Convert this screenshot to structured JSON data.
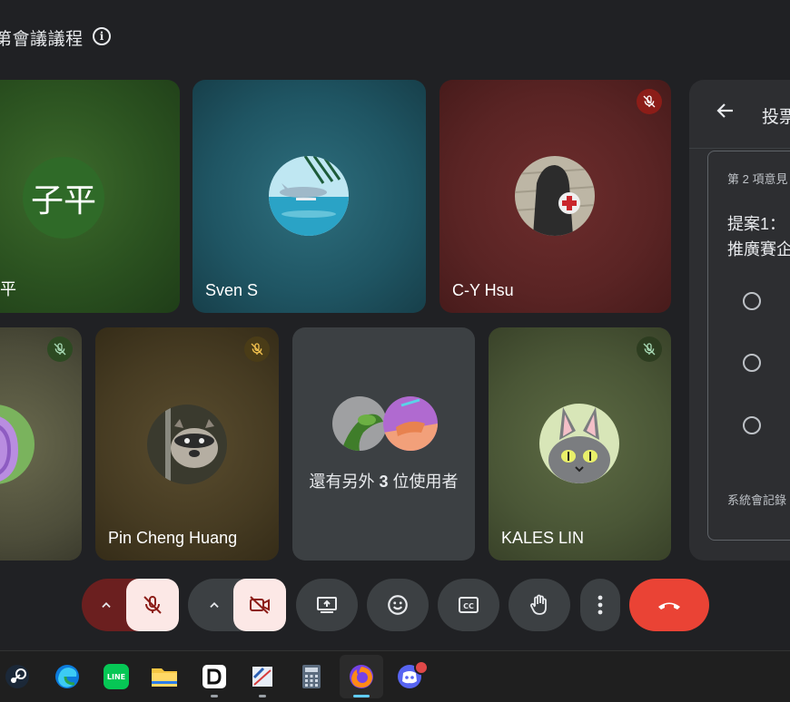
{
  "meeting": {
    "title": "第會議議程",
    "info_icon": "info-icon"
  },
  "tiles": [
    {
      "name": "子平",
      "initials": "子平",
      "name_shown": "平",
      "mic": "on"
    },
    {
      "name": "Sven S",
      "mic": "on"
    },
    {
      "name": "C-Y Hsu",
      "mic": "muted"
    },
    {
      "name": "",
      "mic": "muted"
    },
    {
      "name": "Pin Cheng Huang",
      "mic": "muted"
    },
    {
      "name": "還有另外 3 位使用者",
      "others_prefix": "還有另外 ",
      "others_count": "3",
      "others_suffix": " 位使用者"
    },
    {
      "name": "KALES LIN",
      "mic": "muted"
    }
  ],
  "side_panel": {
    "title": "投票",
    "subtitle": "第 2 項意見",
    "question_line1": "提案1：",
    "question_line2": "推廣賽企",
    "footer": "系統會記錄"
  },
  "controls": {
    "mic": {
      "state": "muted",
      "icon": "mic-off-icon"
    },
    "camera": {
      "state": "off",
      "icon": "videocam-off-icon"
    },
    "present": {
      "icon": "present-screen-icon"
    },
    "reactions": {
      "icon": "emoji-icon"
    },
    "captions": {
      "icon": "captions-icon"
    },
    "raise_hand": {
      "icon": "raise-hand-icon"
    },
    "more": {
      "icon": "more-vert-icon"
    },
    "leave": {
      "icon": "call-end-icon"
    }
  },
  "colors": {
    "background": "#202124",
    "leave_red": "#ea4335",
    "mic_muted_bg": "#6b1f1f",
    "toggle_off_bg": "#fce8e6",
    "control_dark": "#3c4043"
  },
  "taskbar": {
    "apps": [
      "steam-icon",
      "edge-icon",
      "line-icon",
      "file-explorer-icon",
      "dash-icon",
      "sniping-tool-icon",
      "calculator-icon",
      "firefox-icon",
      "discord-icon"
    ],
    "line_label": "LINE"
  }
}
